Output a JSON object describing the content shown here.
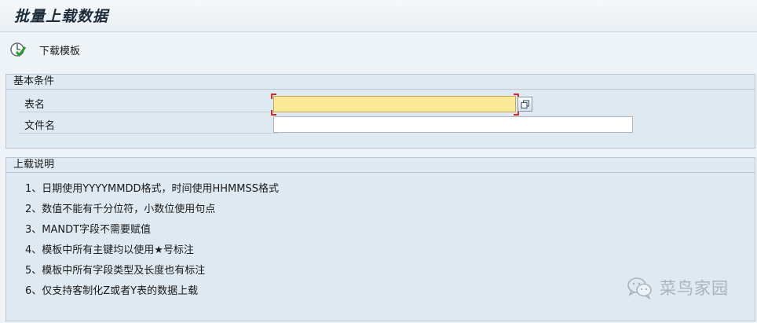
{
  "window": {
    "title": "批量上载数据"
  },
  "toolbar": {
    "download_template_label": "下载模板"
  },
  "conditions": {
    "header": "基本条件",
    "table_name": {
      "label": "表名",
      "value": ""
    },
    "file_name": {
      "label": "文件名",
      "value": ""
    }
  },
  "notes": {
    "header": "上载说明",
    "items": [
      "1、日期使用YYYYMMDD格式，时间使用HHMMSS格式",
      "2、数值不能有千分位符，小数位使用句点",
      "3、MANDT字段不需要赋值",
      "4、模板中所有主键均以使用★号标注",
      "5、模板中所有字段类型及长度也有标注",
      "6、仅支持客制化Z或者Y表的数据上载"
    ]
  },
  "watermark": {
    "text": "菜鸟家园",
    "icon": "wechat-icon"
  },
  "colors": {
    "background": "#eef3f7",
    "panel": "#dfe9f1",
    "required_field": "#fde99a"
  }
}
